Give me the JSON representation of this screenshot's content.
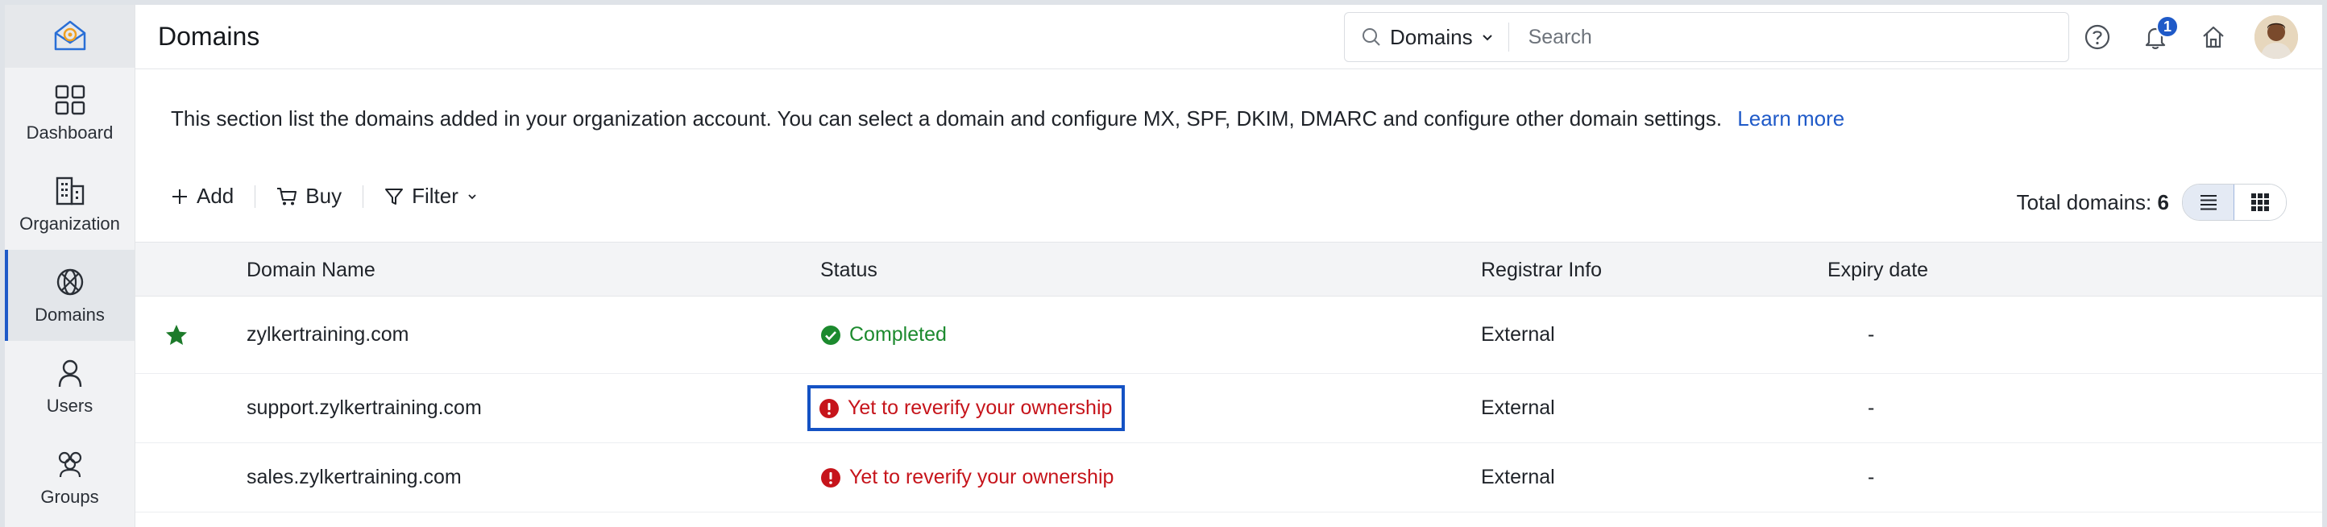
{
  "header": {
    "title": "Domains",
    "search": {
      "scope": "Domains",
      "placeholder": "Search"
    },
    "notifications_count": "1"
  },
  "sidebar": {
    "items": [
      {
        "label": "Dashboard",
        "icon": "dashboard-icon"
      },
      {
        "label": "Organization",
        "icon": "organization-icon"
      },
      {
        "label": "Domains",
        "icon": "domains-icon",
        "active": true
      },
      {
        "label": "Users",
        "icon": "users-icon"
      },
      {
        "label": "Groups",
        "icon": "groups-icon"
      }
    ]
  },
  "main": {
    "description": "This section list the domains added in your organization account. You can select a domain and configure MX, SPF, DKIM, DMARC and configure other domain settings.",
    "learn_more": "Learn more",
    "toolbar": {
      "add": "Add",
      "buy": "Buy",
      "filter": "Filter"
    },
    "total_label": "Total domains:",
    "total_value": "6"
  },
  "table": {
    "headers": [
      "Domain Name",
      "Status",
      "Registrar Info",
      "Expiry date"
    ],
    "rows": [
      {
        "domain": "zylkertraining.com",
        "status": "Completed",
        "registrar": "External",
        "expiry": "-"
      },
      {
        "domain": "support.zylkertraining.com",
        "status": "Yet to reverify your ownership",
        "registrar": "External",
        "expiry": "-"
      },
      {
        "domain": "sales.zylkertraining.com",
        "status": "Yet to reverify your ownership",
        "registrar": "External",
        "expiry": "-"
      }
    ]
  },
  "colors": {
    "accent": "#1f5ac8",
    "success": "#1c8a2e",
    "error": "#c6141b",
    "highlight_border": "#1452c4"
  }
}
